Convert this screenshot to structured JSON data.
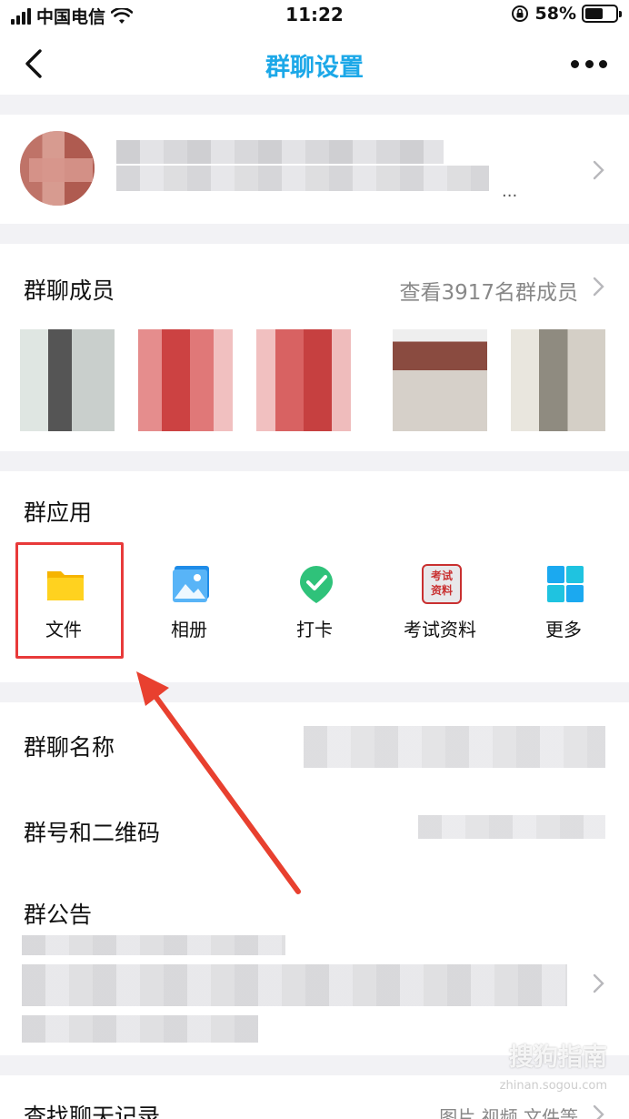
{
  "status_bar": {
    "carrier": "中国电信",
    "time": "11:22",
    "battery": "58%",
    "battery_level": 0.58
  },
  "nav": {
    "title": "群聊设置",
    "back_icon": "chevron-left-icon",
    "more_icon": "more-dots-icon"
  },
  "group_header": {
    "description_fragment": "...",
    "accent": "#1ca8e8"
  },
  "members": {
    "title": "群聊成员",
    "view_all": "查看3917名群成员"
  },
  "apps": {
    "title": "群应用",
    "items": [
      {
        "label": "文件",
        "icon": "folder-icon"
      },
      {
        "label": "相册",
        "icon": "photo-icon"
      },
      {
        "label": "打卡",
        "icon": "checkin-icon"
      },
      {
        "label": "考试资料",
        "icon": "exam-materials-icon",
        "icon_text_top": "考试",
        "icon_text_bottom": "资料"
      },
      {
        "label": "更多",
        "icon": "grid-icon"
      }
    ]
  },
  "settings": {
    "group_name_label": "群聊名称",
    "group_number_label": "群号和二维码",
    "announcement_label": "群公告"
  },
  "find_history": {
    "label": "查找聊天记录",
    "filters": "图片  视频  文件等"
  },
  "watermark": {
    "text": "搜狗指南",
    "sub": "zhinan.sogou.com"
  },
  "colors": {
    "highlight_box": "#e83a3a",
    "arrow": "#e8402f"
  }
}
